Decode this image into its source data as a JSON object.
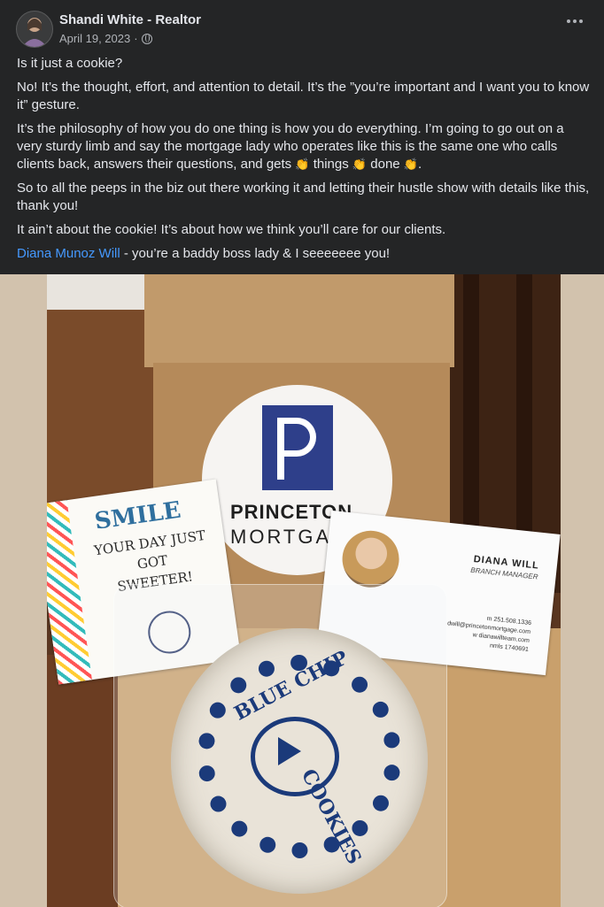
{
  "post": {
    "author": "Shandi White - Realtor",
    "date": "April 19, 2023",
    "separator": "·",
    "privacy_icon": "globe-icon",
    "menu_icon": "more-options-icon"
  },
  "text": {
    "p1": "Is it just a cookie?",
    "p2": "No!  It’s the thought, effort, and attention to detail.  It’s the ”you’re important and I want you to know it” gesture.",
    "p3a": "It’s the philosophy of how you do one thing is how you do everything.  I’m going to go out on a very sturdy limb and say the mortgage lady who operates like this is the same one who calls clients back, answers their questions, and gets ",
    "p3b": " things ",
    "p3c": " done ",
    "p3d": ".",
    "clap": "👏",
    "p4": "So to all the peeps in the biz out there working it and letting their hustle show with details like this, thank you!",
    "p5": "It ain’t about the cookie!  It’s about how we think you’ll care for our clients.",
    "mention": "Diana Munoz Will",
    "p6": " - you’re a baddy boss lady & I seeeeeee you!"
  },
  "photo": {
    "logo_line1": "PRINCETON",
    "logo_line2": "MORTGAGE",
    "smile_title": "SMILE",
    "smile_line1": "YOUR DAY JUST",
    "smile_line2": "GOT",
    "smile_line3": "SWEETER!",
    "card_name": "DIANA WILL",
    "card_title": "BRANCH MANAGER",
    "card_m": "m 251.508.1336",
    "card_email": "dwill@princetonmortgage.com",
    "card_w": "w dianawillteam.com",
    "card_nmls": "nmls 1740691",
    "cookie_top": "BLUE CHIP",
    "cookie_bottom": "COOKIES"
  },
  "colors": {
    "background": "#242526",
    "text": "#e4e6eb",
    "link": "#4599ff",
    "meta": "#b0b3b8"
  }
}
